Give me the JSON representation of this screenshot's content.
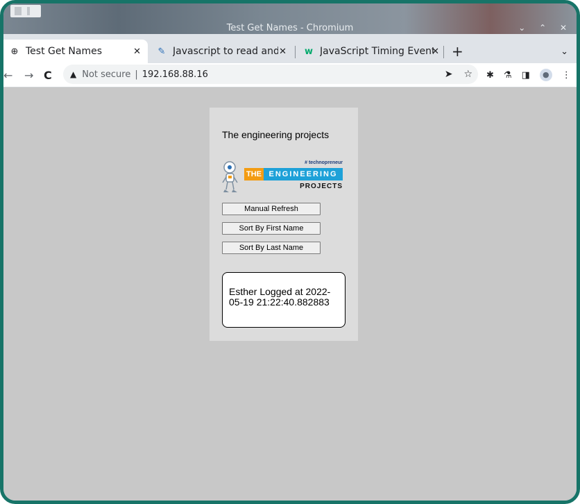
{
  "window": {
    "title": "Test Get Names - Chromium",
    "controls": "⌄ ⌃ ✕"
  },
  "tabs": [
    {
      "label": "Test Get Names",
      "close": "✕"
    },
    {
      "label": "Javascript to read and di",
      "close": "✕"
    },
    {
      "label": "JavaScript Timing Event",
      "close": "✕"
    }
  ],
  "tabstrip": {
    "new_tab": "+",
    "menu": "⌄"
  },
  "toolbar": {
    "back": "←",
    "forward": "→",
    "reload": "C",
    "warning": "▲",
    "security_label": "Not secure",
    "separator": "|",
    "url": "192.168.88.16",
    "send": "➤",
    "bookmark": "☆"
  },
  "page": {
    "heading": "The engineering projects",
    "logo": {
      "tagline": "# technopreneur",
      "the": "THE",
      "engineering": "ENGINEERING",
      "projects": "PROJECTS"
    },
    "buttons": {
      "manual_refresh": "Manual Refresh",
      "sort_first": "Sort By First Name",
      "sort_last": "Sort By Last Name"
    },
    "log_message": "Esther Logged at 2022-05-19 21:22:40.882883"
  },
  "colors": {
    "frame_border": "#177468",
    "page_bg": "#c8c8c8",
    "card_bg": "#dcdcdc",
    "logo_orange": "#f39c12",
    "logo_blue": "#1ea1d8"
  }
}
